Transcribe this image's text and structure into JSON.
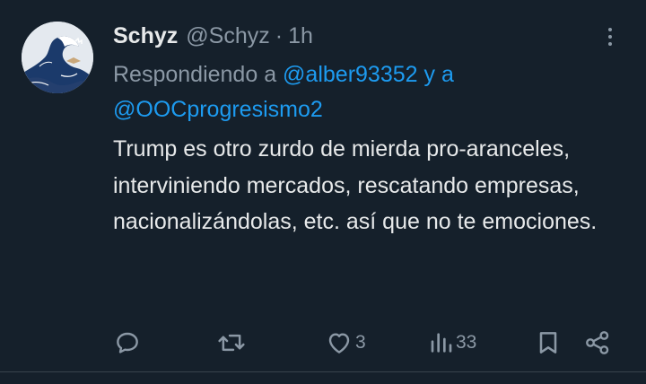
{
  "tweet": {
    "author": {
      "display_name": "Schyz",
      "handle": "@Schyz",
      "separator": "·",
      "time": "1h"
    },
    "reply_to": {
      "prefix": "Respondiendo a",
      "mention_1": "@alber93352",
      "conjunction": "y a",
      "mention_2": "@OOCprogresismo2"
    },
    "text": "Trump es otro zurdo de mierda pro-aranceles, interviniendo mercados, rescatando empresas, nacionalizándolas, etc. así que no te emociones.",
    "actions": {
      "reply_icon": "comment-icon",
      "retweet_icon": "retweet-icon",
      "like_icon": "heart-icon",
      "like_count": "3",
      "views_icon": "bar-chart-icon",
      "views_count": "33",
      "bookmark_icon": "bookmark-icon",
      "share_icon": "share-icon"
    }
  },
  "colors": {
    "background": "#15202b",
    "text_primary": "#e7e9ea",
    "text_secondary": "#8b98a5",
    "link": "#1d9bf0"
  }
}
